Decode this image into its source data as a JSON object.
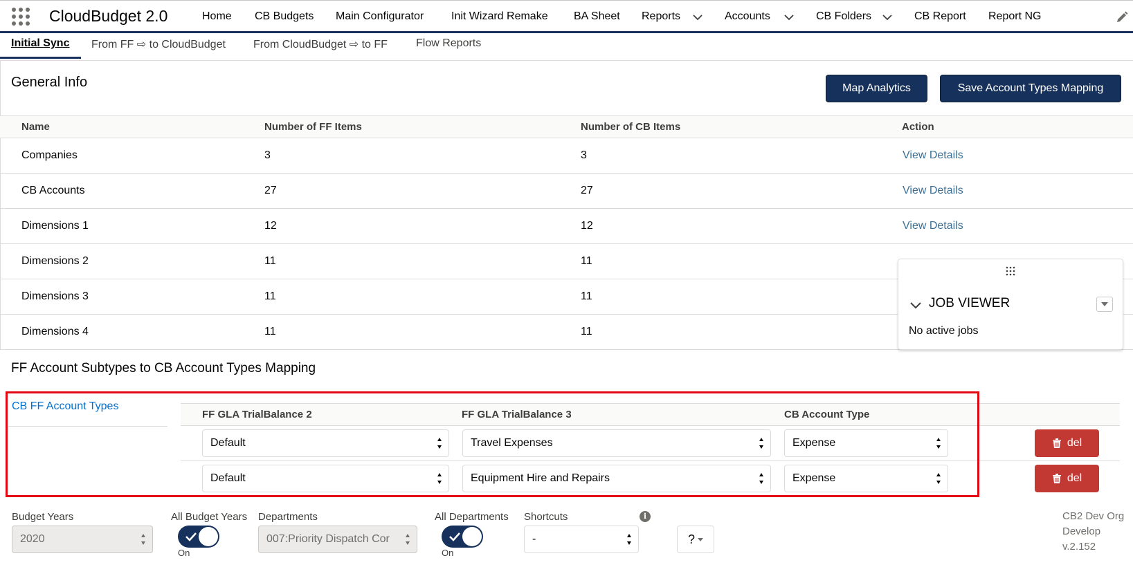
{
  "header": {
    "app_name": "CloudBudget 2.0",
    "nav": [
      {
        "label": "Home",
        "has_menu": false
      },
      {
        "label": "CB Budgets",
        "has_menu": false
      },
      {
        "label": "Main Configurator",
        "has_menu": false
      },
      {
        "label": "Init Wizard Remake",
        "has_menu": false
      },
      {
        "label": "BA Sheet",
        "has_menu": false
      },
      {
        "label": "Reports",
        "has_menu": true
      },
      {
        "label": "Accounts",
        "has_menu": true
      },
      {
        "label": "CB Folders",
        "has_menu": true
      },
      {
        "label": "CB Report",
        "has_menu": false
      },
      {
        "label": "Report NG",
        "has_menu": false
      }
    ]
  },
  "subtabs": [
    {
      "label": "Initial Sync",
      "active": true
    },
    {
      "label": "From FF ⇨ to CloudBudget",
      "active": false
    },
    {
      "label": "From CloudBudget ⇨ to FF",
      "active": false
    },
    {
      "label": "Flow Reports",
      "active": false
    }
  ],
  "general_info": {
    "title": "General Info",
    "map_analytics_label": "Map Analytics",
    "save_mapping_label": "Save Account Types Mapping",
    "columns": [
      "Name",
      "Number of FF Items",
      "Number of CB Items",
      "Action"
    ],
    "rows": [
      {
        "name": "Companies",
        "ff": "3",
        "cb": "3",
        "action": "View Details"
      },
      {
        "name": "CB Accounts",
        "ff": "27",
        "cb": "27",
        "action": "View Details"
      },
      {
        "name": "Dimensions 1",
        "ff": "12",
        "cb": "12",
        "action": "View Details"
      },
      {
        "name": "Dimensions 2",
        "ff": "11",
        "cb": "11",
        "action": ""
      },
      {
        "name": "Dimensions 3",
        "ff": "11",
        "cb": "11",
        "action": ""
      },
      {
        "name": "Dimensions 4",
        "ff": "11",
        "cb": "11",
        "action": ""
      }
    ]
  },
  "job_viewer": {
    "title": "JOB VIEWER",
    "empty_text": "No active jobs"
  },
  "mapping": {
    "title": "FF Account Subtypes to CB Account Types Mapping",
    "tab_label": "CB FF Account Types",
    "columns": [
      "FF GLA TrialBalance 2",
      "FF GLA TrialBalance 3",
      "CB Account Type"
    ],
    "rows": [
      {
        "tb2": "Default",
        "tb3": "Travel Expenses",
        "type": "Expense",
        "del_label": "del"
      },
      {
        "tb2": "Default",
        "tb3": "Equipment Hire and Repairs",
        "type": "Expense",
        "del_label": "del"
      }
    ]
  },
  "footer": {
    "budget_years_label": "Budget Years",
    "budget_years_value": "2020",
    "all_budget_years_label": "All Budget Years",
    "all_budget_years_state": "On",
    "departments_label": "Departments",
    "departments_value": "007:Priority Dispatch Cor",
    "all_departments_label": "All Departments",
    "all_departments_state": "On",
    "shortcuts_label": "Shortcuts",
    "shortcuts_value": "-",
    "help_label": "?",
    "org_line1": "CB2 Dev Org",
    "org_line2": "Develop",
    "org_line3": "v.2.152"
  },
  "colors": {
    "brand_navy": "#16325c",
    "danger_red": "#c23934",
    "highlight_red": "#e30613",
    "link_blue": "#3a6f96"
  }
}
